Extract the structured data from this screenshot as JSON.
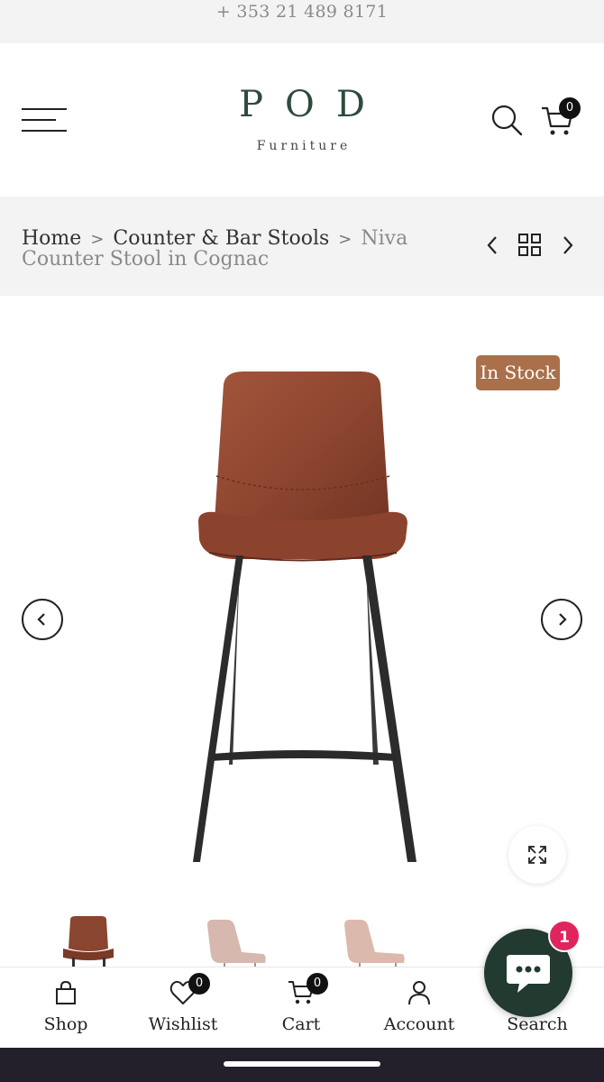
{
  "topbar": {
    "phone": "+ 353 21 489 8171"
  },
  "header": {
    "logo_brand": "POD",
    "logo_sub": "Furniture",
    "menu_icon": "hamburger-menu-icon",
    "search_icon": "search-icon",
    "cart_icon": "cart-icon",
    "cart_count": "0"
  },
  "breadcrumb": {
    "items": [
      {
        "label": "Home"
      },
      {
        "label": "Counter & Bar Stools"
      }
    ],
    "current": "Niva Counter Stool in Cognac",
    "separator": ">",
    "prev_icon": "chevron-left-icon",
    "grid_icon": "grid-icon",
    "next_icon": "chevron-right-icon"
  },
  "product": {
    "stock_label": "In Stock",
    "image_icon": "bar-stool-image",
    "zoom_icon": "expand-icon"
  },
  "thumbnails": [
    {
      "name": "cognac-stool-thumb",
      "color": "#8a4530"
    },
    {
      "name": "pink-chair-thumb",
      "color": "#d6b8ae"
    },
    {
      "name": "blush-chair-thumb",
      "color": "#dcb9ad"
    }
  ],
  "chat": {
    "icon": "chat-bubble-icon",
    "badge": "1"
  },
  "bottom_nav": {
    "items": [
      {
        "label": "Shop",
        "icon": "shopping-bag-icon"
      },
      {
        "label": "Wishlist",
        "icon": "heart-icon",
        "badge": "0"
      },
      {
        "label": "Cart",
        "icon": "cart-icon",
        "badge": "0"
      },
      {
        "label": "Account",
        "icon": "user-icon"
      },
      {
        "label": "Search",
        "icon": "search-icon"
      }
    ]
  },
  "colors": {
    "brand_green": "#2f4a3c",
    "stock_badge": "#a9704b",
    "chat_bg": "#223a2f",
    "chat_badge": "#e0245e"
  }
}
